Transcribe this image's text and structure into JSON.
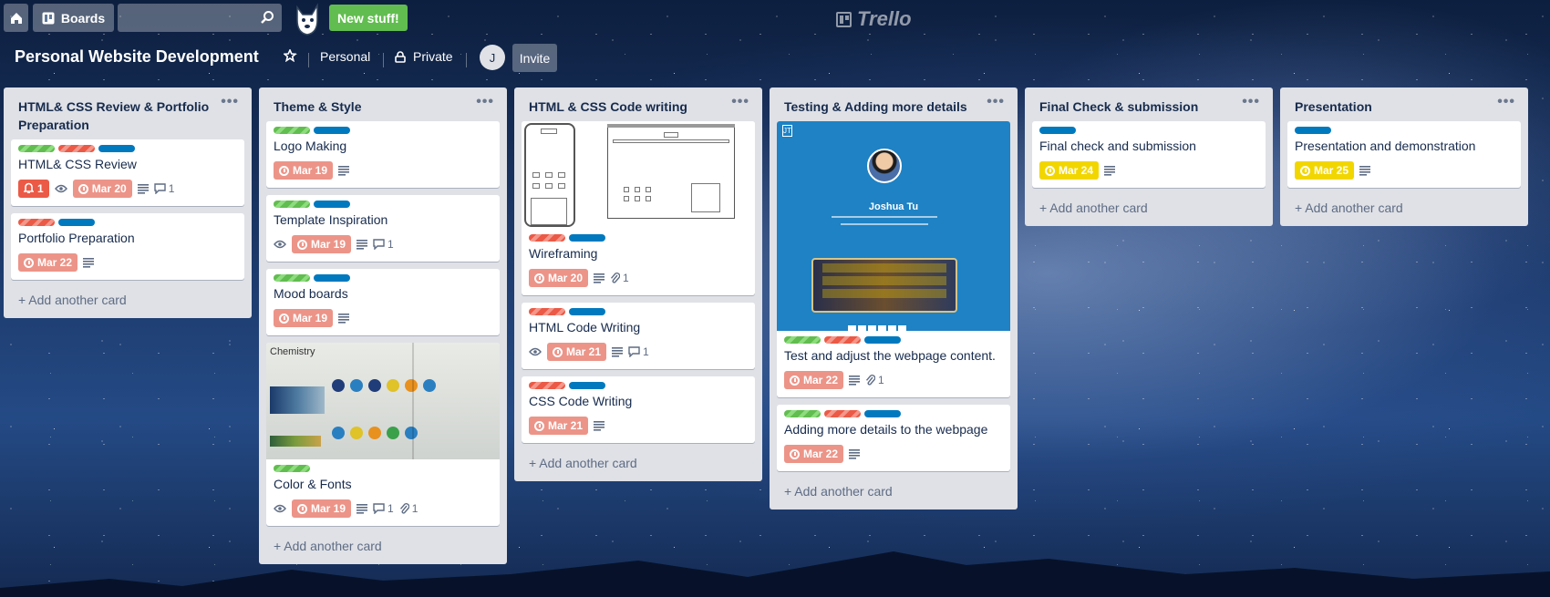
{
  "header": {
    "boards_label": "Boards",
    "new_stuff": "New stuff!",
    "logo_text": "Trello"
  },
  "board": {
    "title": "Personal Website Development",
    "team": "Personal",
    "visibility": "Private",
    "avatar_initial": "J",
    "invite": "Invite"
  },
  "add_card_label": "Add another card",
  "lists": [
    {
      "title": "HTML& CSS Review & Portfolio Preparation",
      "cards": [
        {
          "labels": [
            "g",
            "r",
            "b"
          ],
          "title": "HTML& CSS Review",
          "notif": "1",
          "due": "Mar 20",
          "comments": "1"
        },
        {
          "labels": [
            "r",
            "b"
          ],
          "title": "Portfolio Preparation",
          "due": "Mar 22"
        }
      ]
    },
    {
      "title": "Theme & Style",
      "cards": [
        {
          "labels": [
            "g",
            "b"
          ],
          "title": "Logo Making",
          "due": "Mar 19"
        },
        {
          "labels": [
            "g",
            "b"
          ],
          "title": "Template Inspiration",
          "due": "Mar 19",
          "comments": "1"
        },
        {
          "labels": [
            "g",
            "b"
          ],
          "title": "Mood boards",
          "due": "Mar 19"
        },
        {
          "cover": "photo",
          "cover_text": "Chemistry",
          "labels": [
            "g"
          ],
          "title": "Color & Fonts",
          "due": "Mar 19",
          "comments": "1",
          "attachments": "1"
        }
      ]
    },
    {
      "title": "HTML & CSS Code writing",
      "cards": [
        {
          "cover": "wireframe",
          "labels": [
            "r",
            "b"
          ],
          "title": "Wireframing",
          "due": "Mar 20",
          "attachments": "1"
        },
        {
          "labels": [
            "r",
            "b"
          ],
          "title": "HTML Code Writing",
          "due": "Mar 21",
          "comments": "1"
        },
        {
          "labels": [
            "r",
            "b"
          ],
          "title": "CSS Code Writing",
          "due": "Mar 21"
        }
      ]
    },
    {
      "title": "Testing & Adding more details",
      "cards": [
        {
          "cover": "site",
          "cover_name": "Joshua Tu",
          "labels": [
            "g",
            "r",
            "b"
          ],
          "title": "Test and adjust the webpage content.",
          "due": "Mar 22",
          "attachments": "1"
        },
        {
          "labels": [
            "g",
            "r",
            "b"
          ],
          "title": "Adding more details to the webpage",
          "due": "Mar 22"
        }
      ]
    },
    {
      "title": "Final Check & submission",
      "cards": [
        {
          "labels": [
            "b"
          ],
          "title": "Final check and submission",
          "due": "Mar 24",
          "due_color": "yellow"
        }
      ]
    },
    {
      "title": "Presentation",
      "cards": [
        {
          "labels": [
            "b"
          ],
          "title": "Presentation and demonstration",
          "due": "Mar 25",
          "due_color": "yellow"
        }
      ]
    }
  ]
}
